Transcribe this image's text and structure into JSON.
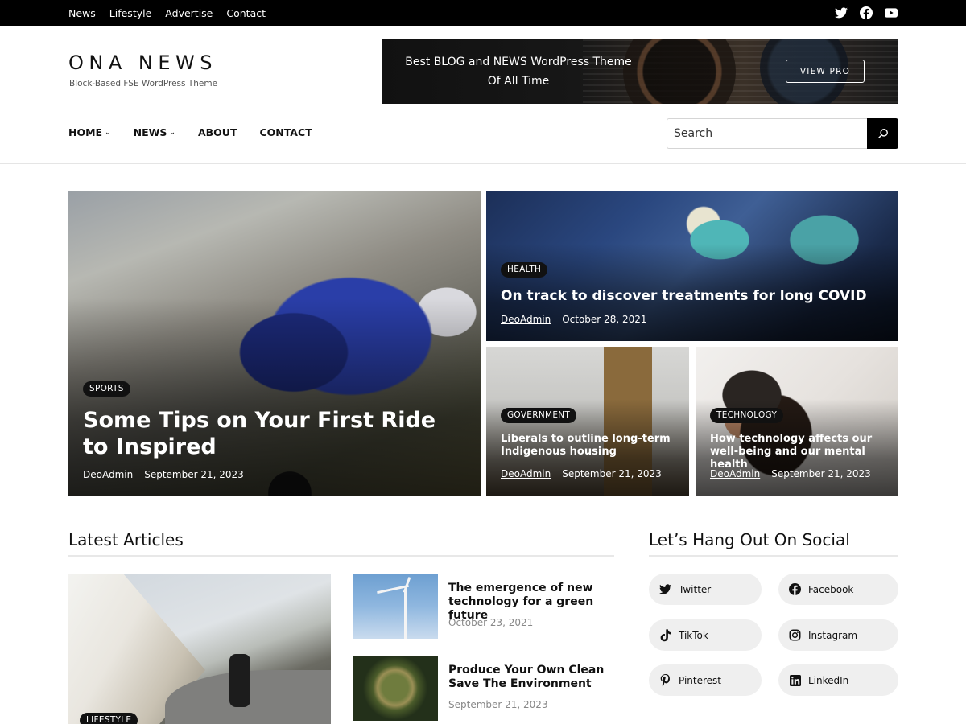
{
  "topbar": {
    "nav": [
      "News",
      "Lifestyle",
      "Advertise",
      "Contact"
    ],
    "social_icons": [
      "twitter-icon",
      "facebook-icon",
      "youtube-icon"
    ]
  },
  "header": {
    "logo": "ONA NEWS",
    "tagline": "Block-Based FSE WordPress Theme",
    "banner": {
      "line1": "Best  BLOG and NEWS WordPress Theme",
      "line2": "Of All Time",
      "button": "VIEW PRO"
    }
  },
  "mainnav": {
    "items": [
      {
        "label": "HOME",
        "has_dropdown": true
      },
      {
        "label": "NEWS",
        "has_dropdown": true
      },
      {
        "label": "ABOUT",
        "has_dropdown": false
      },
      {
        "label": "CONTACT",
        "has_dropdown": false
      }
    ],
    "search_placeholder": "Search"
  },
  "featured": [
    {
      "category": "SPORTS",
      "title": "Some Tips on Your First Ride to Inspired",
      "author": "DeoAdmin",
      "date": "September 21, 2023"
    },
    {
      "category": "HEALTH",
      "title": "On track to discover treatments for long COVID",
      "author": "DeoAdmin",
      "date": "October 28, 2021"
    },
    {
      "category": "GOVERNMENT",
      "title": "Liberals to outline long-term Indigenous housing",
      "author": "DeoAdmin",
      "date": "September 21, 2023"
    },
    {
      "category": "TECHNOLOGY",
      "title": "How technology affects our well-being and our mental health",
      "author": "DeoAdmin",
      "date": "September 21, 2023"
    }
  ],
  "latest": {
    "title": "Latest Articles",
    "big_category": "LIFESTYLE",
    "articles": [
      {
        "title": "The emergence of new technology for a green future",
        "date": "October 23, 2021"
      },
      {
        "title": "Produce Your Own Clean Save The Environment",
        "date": "September 21, 2023"
      }
    ]
  },
  "social": {
    "title": "Let’s Hang Out On Social",
    "buttons": [
      {
        "label": "Twitter",
        "icon": "twitter-icon"
      },
      {
        "label": "Facebook",
        "icon": "facebook-icon"
      },
      {
        "label": "TikTok",
        "icon": "tiktok-icon"
      },
      {
        "label": "Instagram",
        "icon": "instagram-icon"
      },
      {
        "label": "Pinterest",
        "icon": "pinterest-icon"
      },
      {
        "label": "LinkedIn",
        "icon": "linkedin-icon"
      }
    ]
  },
  "colors": {
    "topbar": "#000000",
    "accent": "#111111",
    "pill_bg": "#efefef"
  }
}
